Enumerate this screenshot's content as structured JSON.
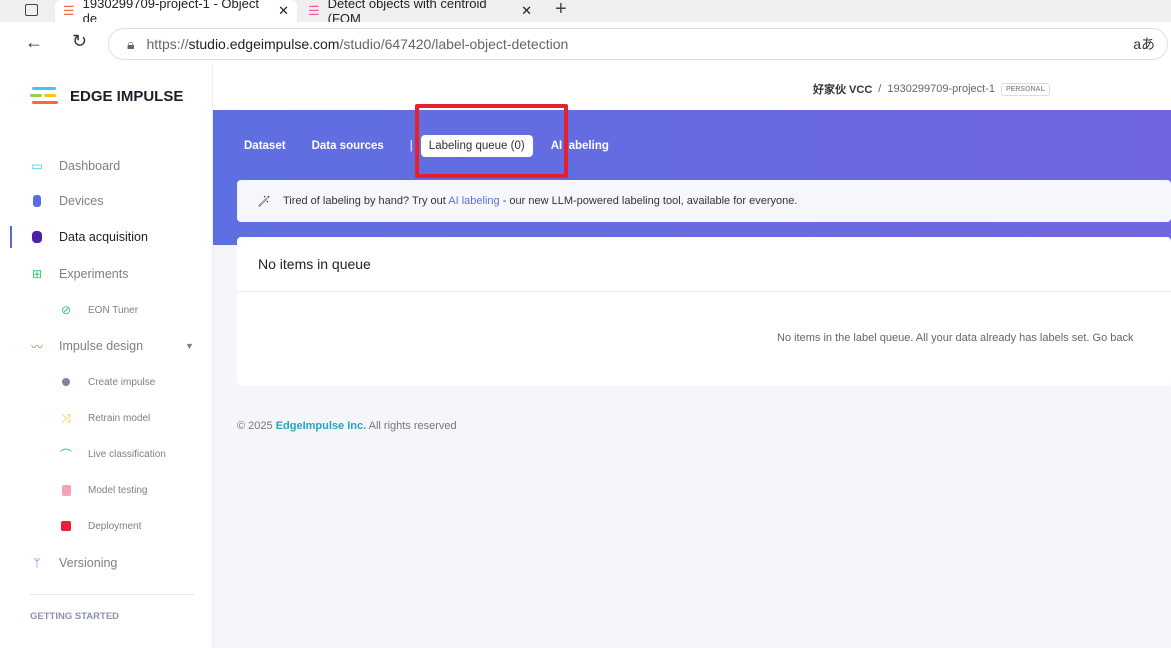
{
  "browser": {
    "tabs": [
      {
        "title": "1930299709-project-1 - Object de"
      },
      {
        "title": "Detect objects with centroid (FOM"
      }
    ],
    "url_prefix": "https://",
    "url_host": "studio.edgeimpulse.com",
    "url_path": "/studio/647420/label-object-detection",
    "close": "✕",
    "new_tab": "+",
    "ime": "aあ"
  },
  "sidebar": {
    "logo": "EDGE IMPULSE",
    "items": [
      {
        "label": "Dashboard",
        "icon": "monitor-icon",
        "color": "#3dc9e9"
      },
      {
        "label": "Devices",
        "icon": "chip-icon",
        "color": "#5b6ee1"
      },
      {
        "label": "Data acquisition",
        "icon": "database-icon",
        "color": "#4b1fa8"
      },
      {
        "label": "Experiments",
        "icon": "grid-icon",
        "color": "#2ecc71"
      },
      {
        "label": "EON Tuner",
        "icon": "compass-icon",
        "color": "#2ecc71"
      },
      {
        "label": "Impulse design",
        "icon": "pulse-icon",
        "color": "#f36a4a"
      },
      {
        "label": "Create impulse",
        "icon": "dot-icon",
        "color": "#7b8799"
      },
      {
        "label": "Retrain model",
        "icon": "shuffle-icon",
        "color": "#f5c518"
      },
      {
        "label": "Live classification",
        "icon": "bezier-icon",
        "color": "#2ecc71"
      },
      {
        "label": "Model testing",
        "icon": "clipboard-icon",
        "color": "#f4a3b3"
      },
      {
        "label": "Deployment",
        "icon": "box-icon",
        "color": "#e8213b"
      },
      {
        "label": "Versioning",
        "icon": "branch-icon",
        "color": "#5b6ee1"
      }
    ],
    "section": "GETTING STARTED"
  },
  "header": {
    "user": "好家伙 VCC",
    "sep": "/",
    "project": "1930299709-project-1",
    "badge": "PERSONAL"
  },
  "tabs": {
    "dataset": "Dataset",
    "sources": "Data sources",
    "divider": "|",
    "queue": "Labeling queue (0)",
    "ai": "AI labeling"
  },
  "info": {
    "pre": "Tired of labeling by hand? Try out ",
    "link": "AI labeling",
    "post": " - our new LLM-powered labeling tool, available for everyone."
  },
  "card": {
    "title": "No items in queue",
    "message": "No items in the label queue. All your data already has labels set. Go back"
  },
  "footer": {
    "pre": "© 2025 ",
    "company": "EdgeImpulse Inc.",
    "post": " All rights reserved"
  }
}
